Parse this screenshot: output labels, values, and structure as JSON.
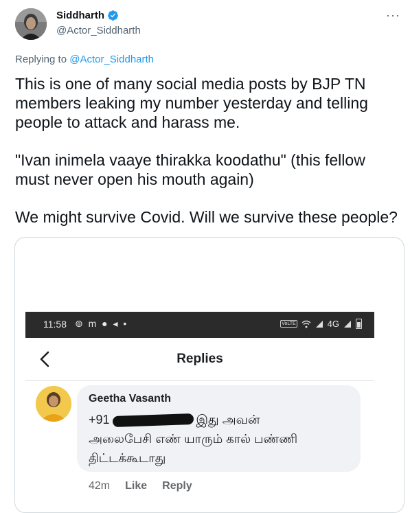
{
  "author": {
    "name": "Siddharth",
    "handle": "@Actor_Siddharth",
    "verified": true
  },
  "more_icon": "more-horizontal-icon",
  "reply_context": {
    "prefix": "Replying to ",
    "target": "@Actor_Siddharth"
  },
  "tweet_paragraphs": [
    "This is one of many social media posts by BJP TN members leaking my number yesterday and telling people to attack and harass me.",
    "\"Ivan inimela vaaye thirakka koodathu\" (this fellow must never open his mouth again)",
    "We might survive Covid. Will we survive these people?"
  ],
  "screenshot": {
    "status_bar": {
      "time": "11:58",
      "left_icons": "⊚ m ● ◂ •",
      "volte": "VoLTE",
      "network": "4G"
    },
    "header": {
      "title": "Replies"
    },
    "comment": {
      "author": "Geetha Vasanth",
      "phone_prefix": "+91",
      "text_after_number": "இது அவன்",
      "text_rest": "அலைபேசி எண் யாரும் கால் பண்ணி திட்டக்கூடாது",
      "time": "42m",
      "like": "Like",
      "reply": "Reply"
    }
  },
  "colors": {
    "link": "#1d9bf0",
    "secondary_text": "#536471",
    "status_bar_bg": "#2b2b2b",
    "bubble_bg": "#f0f2f5"
  }
}
